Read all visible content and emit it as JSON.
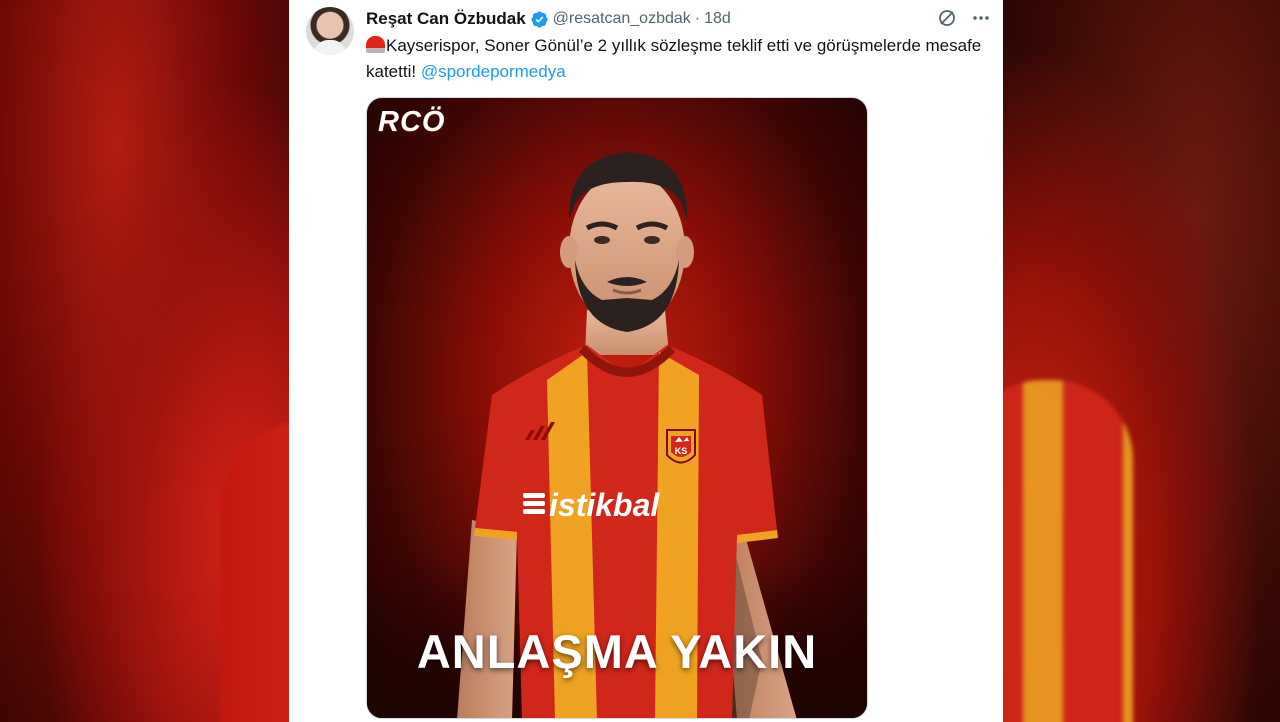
{
  "author": {
    "display_name": "Reşat Can Özbudak",
    "handle": "@resatcan_ozbdak",
    "separator": "·",
    "time": "18d"
  },
  "tweet": {
    "text": "Kayserispor, Soner Gönül’e 2 yıllık sözleşme teklif etti ve görüşmelerde mesafe katetti!",
    "mention": "@spordepormedya"
  },
  "media": {
    "logo": "RCÖ",
    "sponsor": "istikbal",
    "crest": "KS",
    "headline": "ANLAŞMA YAKIN"
  },
  "icons": {
    "verified": "verified-badge-icon",
    "grok": "grok-icon",
    "more": "more-icon",
    "siren": "siren-emoji-icon"
  },
  "colors": {
    "accent": "#1d9bf0",
    "jersey_red": "#d1261a",
    "jersey_yellow": "#f0a323"
  }
}
